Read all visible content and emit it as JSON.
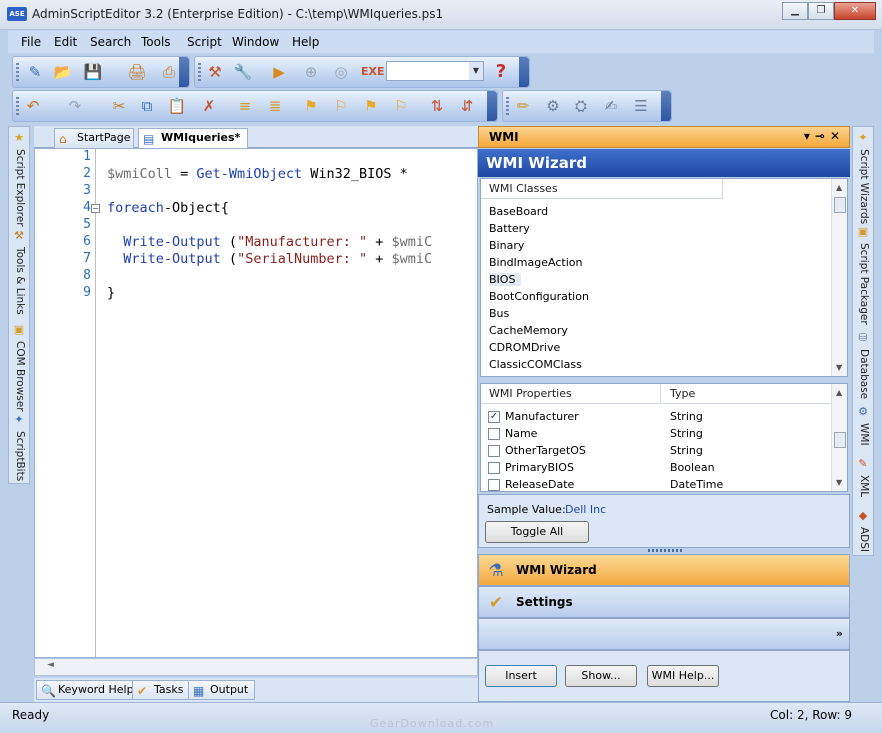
{
  "window": {
    "app_icon": "ASE",
    "title": "AdminScriptEditor 3.2 (Enterprise Edition) - C:\\temp\\WMIqueries.ps1",
    "minimize_icon": "minimize-icon",
    "restore_icon": "restore-icon",
    "close_icon": "close-icon"
  },
  "menu": [
    "File",
    "Edit",
    "Search",
    "Tools",
    "Script",
    "Window",
    "Help"
  ],
  "doc_tabs": [
    {
      "label": "StartPage",
      "icon": "home-icon",
      "active": false
    },
    {
      "label": "WMIqueries*",
      "icon": "script-file-icon",
      "active": true
    }
  ],
  "left_side_tabs": [
    "Script Explorer",
    "Tools & Links",
    "COM Browser",
    "ScriptBits"
  ],
  "right_side_tabs": [
    "Script Wizards",
    "Script Packager",
    "Database",
    "WMI",
    "XML",
    "ADSI"
  ],
  "editor": {
    "line_numbers": [
      "1",
      "2",
      "3",
      "4",
      "5",
      "6",
      "7",
      "8",
      "9"
    ],
    "lines": [
      [],
      [
        {
          "t": "$wmiColl",
          "c": "var"
        },
        {
          "t": " = ",
          "c": "plain"
        },
        {
          "t": "Get-WmiObject",
          "c": "kw"
        },
        {
          "t": " Win32_BIOS *",
          "c": "plain"
        }
      ],
      [],
      [
        {
          "t": "foreach",
          "c": "kw"
        },
        {
          "t": "-Object{",
          "c": "plain"
        }
      ],
      [],
      [
        {
          "t": "  Write-Output",
          "c": "kw"
        },
        {
          "t": " (",
          "c": "plain"
        },
        {
          "t": "\"Manufacturer: \"",
          "c": "str"
        },
        {
          "t": " + ",
          "c": "plain"
        },
        {
          "t": "$wmiC",
          "c": "var"
        }
      ],
      [
        {
          "t": "  Write-Output",
          "c": "kw"
        },
        {
          "t": " (",
          "c": "plain"
        },
        {
          "t": "\"SerialNumber: \"",
          "c": "str"
        },
        {
          "t": " + ",
          "c": "plain"
        },
        {
          "t": "$wmiC",
          "c": "var"
        }
      ],
      [],
      [
        {
          "t": "}",
          "c": "plain"
        }
      ]
    ]
  },
  "bottom_tabs": [
    {
      "label": "Keyword Help",
      "icon": "keyword-help-icon"
    },
    {
      "label": "Tasks",
      "icon": "tasks-icon"
    },
    {
      "label": "Output",
      "icon": "output-icon"
    }
  ],
  "wmi_panel": {
    "header": "WMI",
    "wizard_title": "WMI Wizard",
    "classes_header": "WMI Classes",
    "classes": [
      "BaseBoard",
      "Battery",
      "Binary",
      "BindImageAction",
      "BIOS",
      "BootConfiguration",
      "Bus",
      "CacheMemory",
      "CDROMDrive",
      "ClassicCOMClass"
    ],
    "selected_class": "BIOS",
    "properties_header": "WMI Properties",
    "type_header": "Type",
    "properties": [
      {
        "name": "Manufacturer",
        "type": "String",
        "checked": true
      },
      {
        "name": "Name",
        "type": "String",
        "checked": false
      },
      {
        "name": "OtherTargetOS",
        "type": "String",
        "checked": false
      },
      {
        "name": "PrimaryBIOS",
        "type": "Boolean",
        "checked": false
      },
      {
        "name": "ReleaseDate",
        "type": "DateTime",
        "checked": false
      }
    ],
    "sample_label": "Sample Value:",
    "sample_value": "Dell Inc",
    "toggle_all": "Toggle All",
    "nav_wizard": "WMI Wizard",
    "nav_settings": "Settings",
    "insert": "Insert",
    "show": "Show...",
    "wmi_help": "WMI Help..."
  },
  "status": {
    "left": "Ready",
    "right": "Col: 2, Row: 9"
  },
  "watermark": "GearDownload.com"
}
